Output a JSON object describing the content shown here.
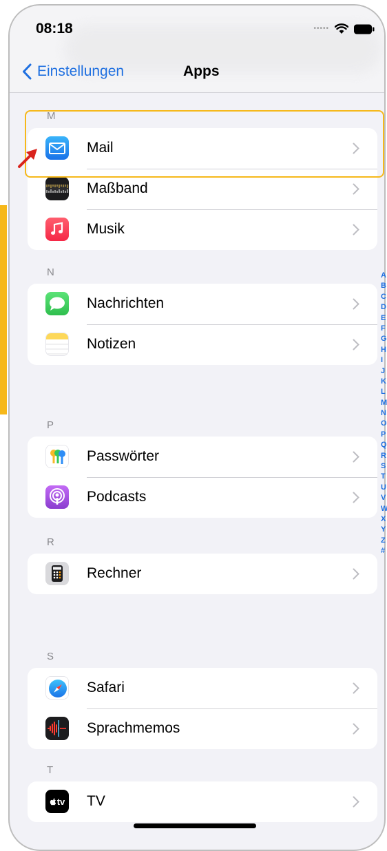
{
  "status_bar": {
    "time": "08:18"
  },
  "nav": {
    "back_label": "Einstellungen",
    "title": "Apps"
  },
  "sections": [
    {
      "letter": "M",
      "items": [
        {
          "label": "Mail",
          "icon": "mail-icon"
        },
        {
          "label": "Maßband",
          "icon": "measure-icon"
        },
        {
          "label": "Musik",
          "icon": "music-icon"
        }
      ]
    },
    {
      "letter": "N",
      "items": [
        {
          "label": "Nachrichten",
          "icon": "messages-icon"
        },
        {
          "label": "Notizen",
          "icon": "notes-icon"
        }
      ]
    },
    {
      "letter": "P",
      "items": [
        {
          "label": "Passwörter",
          "icon": "passwords-icon"
        },
        {
          "label": "Podcasts",
          "icon": "podcasts-icon"
        }
      ]
    },
    {
      "letter": "R",
      "items": [
        {
          "label": "Rechner",
          "icon": "calculator-icon"
        }
      ]
    },
    {
      "letter": "S",
      "items": [
        {
          "label": "Safari",
          "icon": "safari-icon"
        },
        {
          "label": "Sprachmemos",
          "icon": "voice-memos-icon"
        }
      ]
    },
    {
      "letter": "T",
      "items": [
        {
          "label": "TV",
          "icon": "tv-icon"
        }
      ]
    }
  ],
  "tv_icon_text": "tv",
  "index_letters": [
    "A",
    "B",
    "C",
    "D",
    "E",
    "F",
    "G",
    "H",
    "I",
    "J",
    "K",
    "L",
    "M",
    "N",
    "O",
    "P",
    "Q",
    "R",
    "S",
    "T",
    "U",
    "V",
    "W",
    "X",
    "Y",
    "Z",
    "#"
  ],
  "colors": {
    "accent": "#1E6FE0",
    "highlight": "#F6B81A",
    "arrow": "#D9231D"
  }
}
